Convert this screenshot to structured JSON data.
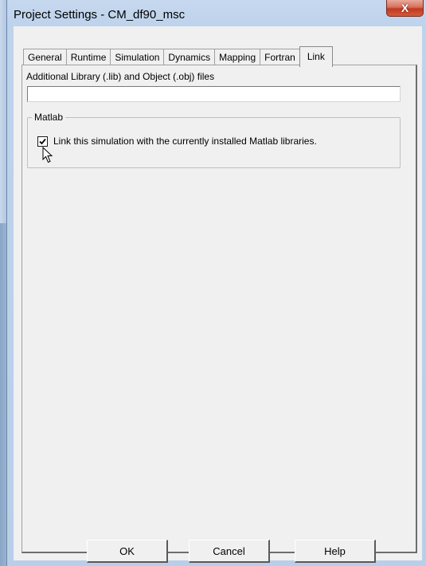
{
  "window": {
    "title": "Project Settings - CM_df90_msc",
    "close_glyph": "X"
  },
  "tabs": [
    {
      "label": "General",
      "active": false
    },
    {
      "label": "Runtime",
      "active": false
    },
    {
      "label": "Simulation",
      "active": false
    },
    {
      "label": "Dynamics",
      "active": false
    },
    {
      "label": "Mapping",
      "active": false
    },
    {
      "label": "Fortran",
      "active": false
    },
    {
      "label": "Link",
      "active": true
    }
  ],
  "link_tab": {
    "library_label": "Additional Library (.lib) and Object (.obj) files",
    "library_value": "",
    "matlab_group": {
      "title": "Matlab",
      "checkbox_label": "Link this simulation with the currently installed Matlab libraries.",
      "checked": true
    }
  },
  "buttons": {
    "ok": "OK",
    "cancel": "Cancel",
    "help": "Help"
  },
  "colors": {
    "close_button": "#c9432a",
    "frame": "#bed3ec",
    "dialog_bg": "#f0f0f0"
  }
}
